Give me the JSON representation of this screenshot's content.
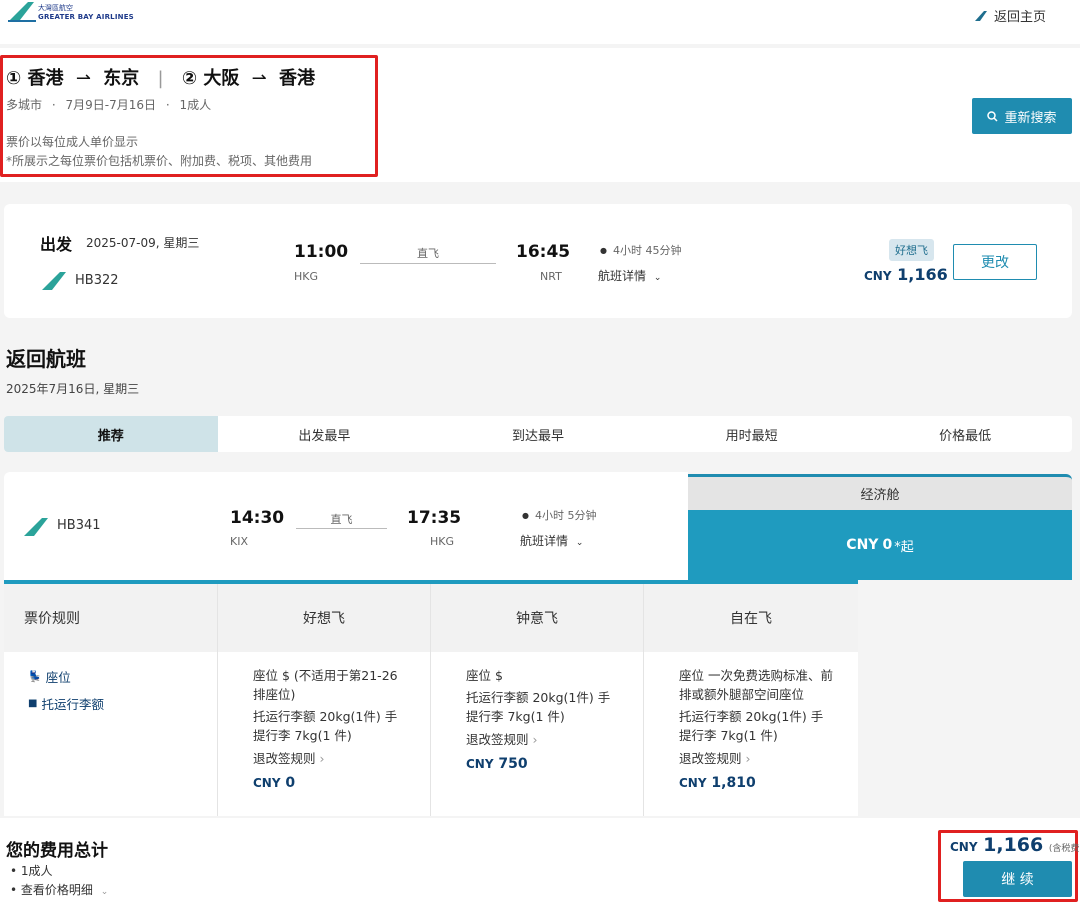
{
  "brand": {
    "name_cn": "大灣區航空",
    "name_en": "GREATER BAY AIRLINES",
    "accent": "#1f8cb0"
  },
  "header": {
    "home_link": "返回主页"
  },
  "summary": {
    "leg1_num": "①",
    "leg1_from": "香港",
    "leg1_to": "东京",
    "leg2_num": "②",
    "leg2_from": "大阪",
    "leg2_to": "香港",
    "trip_type": "多城市",
    "dates": "7月9日-7月16日",
    "pax": "1成人",
    "note1": "票价以每位成人单价显示",
    "note2": "*所展示之每位票价包括机票价、附加费、税项、其他费用",
    "research_button": "重新搜索"
  },
  "outbound": {
    "label": "出发",
    "date": "2025-07-09, 星期三",
    "flight_no": "HB322",
    "dep_time": "11:00",
    "dep_code": "HKG",
    "type": "直飞",
    "arr_time": "16:45",
    "arr_code": "NRT",
    "duration": "4小时 45分钟",
    "details": "航班详情",
    "fare_badge": "好想飞",
    "currency": "CNY",
    "price": "1,166",
    "change_button": "更改"
  },
  "return_section": {
    "title": "返回航班",
    "date": "2025年7月16日, 星期三"
  },
  "sort_tabs": [
    "推荐",
    "出发最早",
    "到达最早",
    "用时最短",
    "价格最低"
  ],
  "return_flight": {
    "flight_no": "HB341",
    "dep_time": "14:30",
    "dep_code": "KIX",
    "type": "直飞",
    "arr_time": "17:35",
    "arr_code": "HKG",
    "duration": "4小时 5分钟",
    "details": "航班详情",
    "cabin": "经济舱",
    "cabin_price_prefix": "CNY",
    "cabin_price": "0",
    "cabin_price_suffix": "*起"
  },
  "fare_table": {
    "rules_header": "票价规则",
    "rule_seat": "座位",
    "rule_bag": "托运行李额",
    "columns": [
      {
        "name": "好想飞",
        "seat": "座位 $ (不适用于第21-26排座位)",
        "bag": "托运行李额 20kg(1件) 手提行李 7kg(1 件)",
        "change": "退改签规则",
        "currency": "CNY",
        "price": "0"
      },
      {
        "name": "钟意飞",
        "seat": "座位 $",
        "bag": "托运行李额 20kg(1件) 手提行李 7kg(1 件)",
        "change": "退改签规则",
        "currency": "CNY",
        "price": "750"
      },
      {
        "name": "自在飞",
        "seat": "座位 一次免费选购标准、前排或额外腿部空间座位",
        "bag": "托运行李额 20kg(1件) 手提行李 7kg(1 件)",
        "change": "退改签规则",
        "currency": "CNY",
        "price": "1,810"
      }
    ]
  },
  "total": {
    "title": "您的费用总计",
    "item1": "1成人",
    "item2": "查看价格明细",
    "currency": "CNY",
    "amount": "1,166",
    "tax_note": "(含税费)",
    "continue_button": "继 续"
  }
}
